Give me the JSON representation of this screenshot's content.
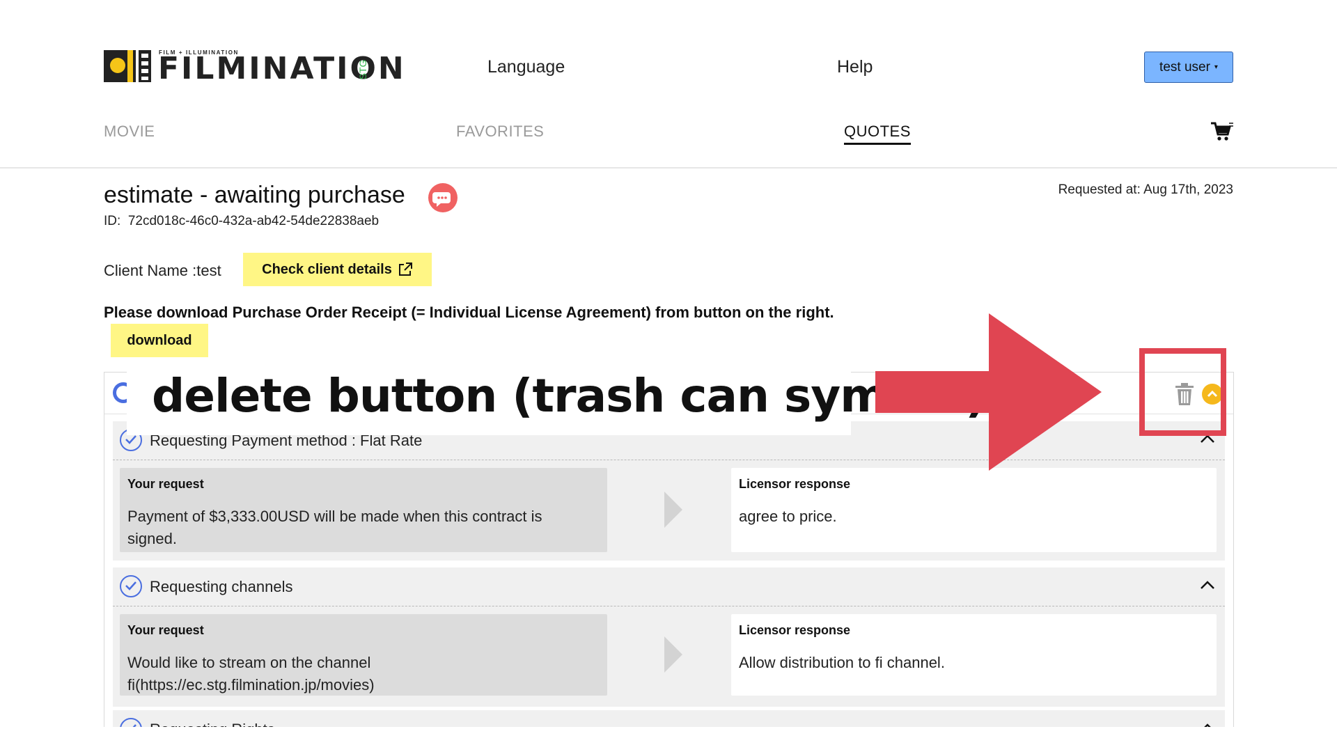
{
  "header": {
    "logo_tagline": "FILM + ILLUMINATION",
    "logo_word": "FILMINATION",
    "logo_env": "STG",
    "nav_language": "Language",
    "nav_help": "Help",
    "user_button": "test user",
    "user_caret": "▾"
  },
  "tabs": [
    {
      "label": "MOVIE",
      "active": false
    },
    {
      "label": "FAVORITES",
      "active": false
    },
    {
      "label": "QUOTES",
      "active": true
    }
  ],
  "quote": {
    "title": "estimate - awaiting purchase",
    "id_label": "ID:",
    "id_value": "72cd018c-46c0-432a-ab42-54de22838aeb",
    "requested": "Requested at: Aug 17th, 2023",
    "client_name": "Client Name :test",
    "check_client_button": "Check client details",
    "instruction": "Please download Purchase Order Receipt (= Individual License Agreement) from button on the right.",
    "download_button": "download"
  },
  "sections": [
    {
      "title": "Requesting Payment method : Flat Rate",
      "request_label": "Your request",
      "request_text": "Payment of $3,333.00USD will be made when this contract is signed.",
      "response_label": "Licensor response",
      "response_text": "agree to price."
    },
    {
      "title": "Requesting channels",
      "request_label": "Your request",
      "request_text": "Would like to stream on the channel fi(https://ec.stg.filmination.jp/movies)",
      "response_label": "Licensor response",
      "response_text": "Allow distribution to fi channel."
    },
    {
      "title": "Requesting Rights"
    }
  ],
  "annotation": {
    "text": "delete button (trash can symbol)",
    "color": "#e04552"
  },
  "colors": {
    "highlight_button": "#fff685",
    "user_button": "#7bb5ff",
    "check_blue": "#4a6ee0",
    "chat_red": "#f06262",
    "collapse_yellow": "#f5b81c"
  },
  "icons": [
    "cart-icon",
    "chat-icon",
    "external-link-icon",
    "trash-icon",
    "chevron-up-icon",
    "check-circle-icon",
    "spinner-icon"
  ]
}
